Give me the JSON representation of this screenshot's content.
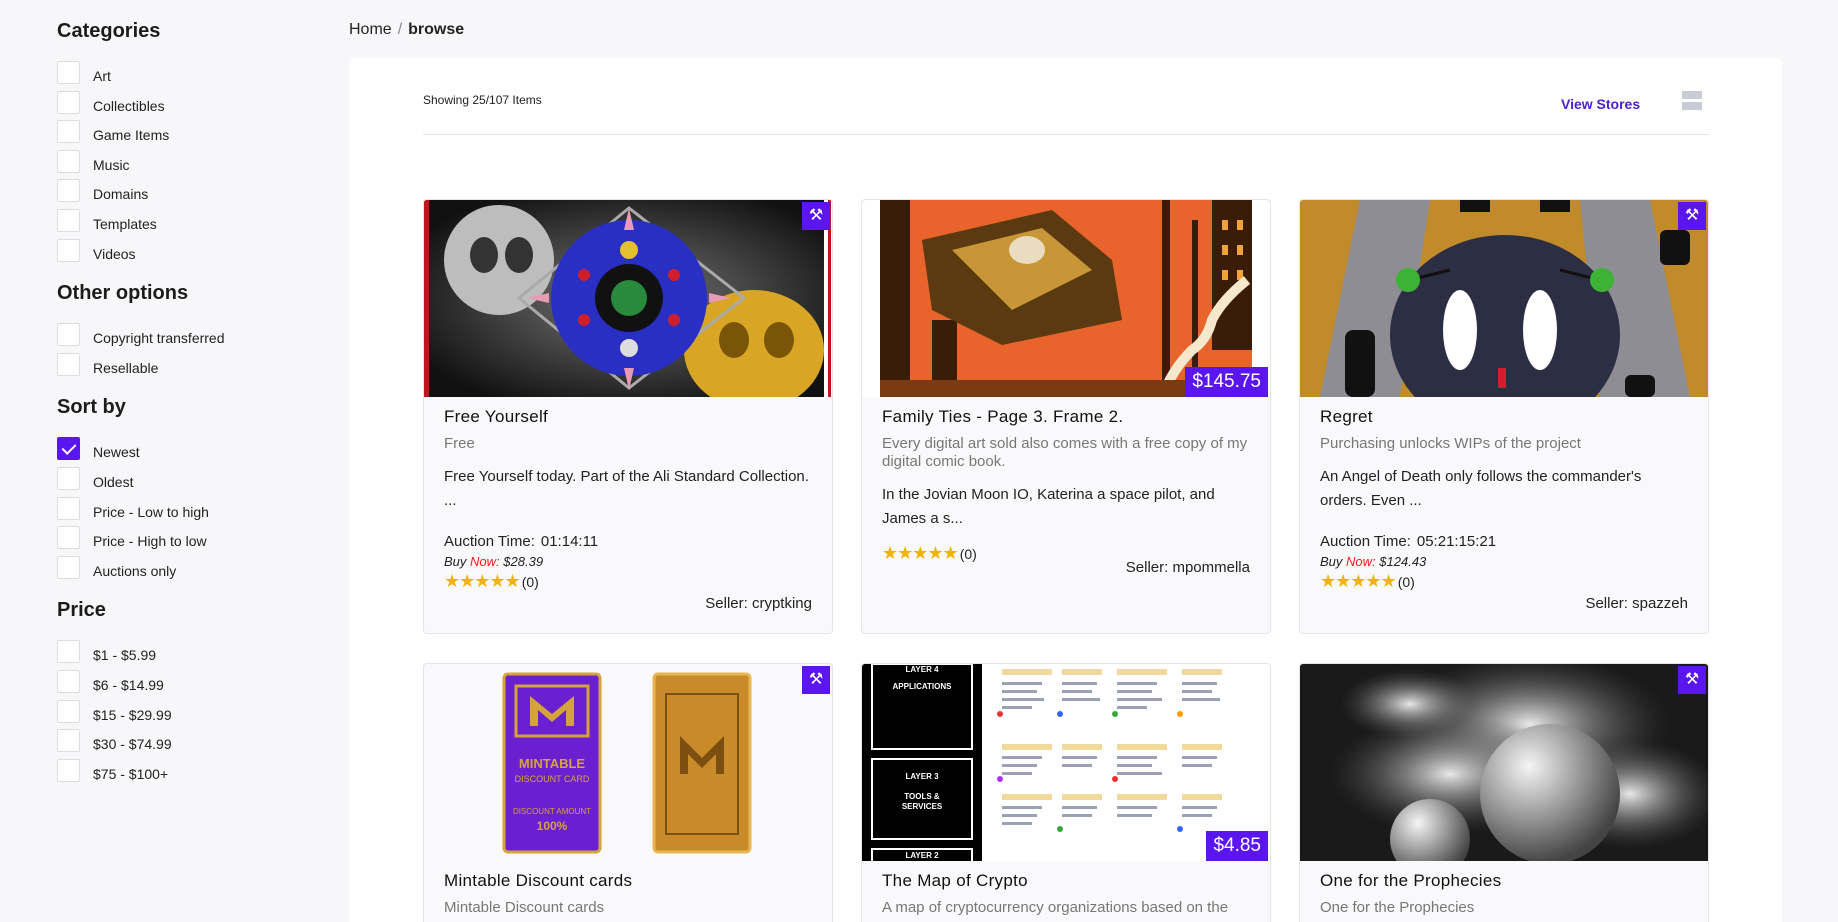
{
  "sidebar": {
    "categories": {
      "heading": "Categories",
      "items": [
        "Art",
        "Collectibles",
        "Game Items",
        "Music",
        "Domains",
        "Templates",
        "Videos"
      ]
    },
    "other": {
      "heading": "Other options",
      "items": [
        "Copyright transferred",
        "Resellable"
      ]
    },
    "sort": {
      "heading": "Sort by",
      "items": [
        "Newest",
        "Oldest",
        "Price - Low to high",
        "Price - High to low",
        "Auctions only"
      ],
      "checked": "Newest"
    },
    "price": {
      "heading": "Price",
      "items": [
        "$1 - $5.99",
        "$6 - $14.99",
        "$15 - $29.99",
        "$30 - $74.99",
        "$75 - $100+"
      ]
    }
  },
  "breadcrumb": {
    "home": "Home",
    "separator": "/",
    "current": "browse"
  },
  "toolbar": {
    "showing": "Showing 25/107 Items",
    "view_stores": "View Stores"
  },
  "icons": {
    "auction": "gavel-icon",
    "star": "star-icon",
    "grid_toggle": "grid-view-icon"
  },
  "colors": {
    "accent": "#5b16f0",
    "link": "#4a1fd3",
    "star": "#f0b400",
    "now": "#ff1a1a"
  },
  "cards": [
    {
      "title": "Free Yourself",
      "subtitle": "Free",
      "description": "Free Yourself today. Part of the Ali Standard Collection. ...",
      "auction_label": "Auction Time:",
      "auction_time": "01:14:11",
      "buy_label": "Buy",
      "now_label": "Now:",
      "buy_price": "$28.39",
      "stars": "★★★★★",
      "rating_count": "(0)",
      "seller": "Seller: cryptking",
      "auction": true
    },
    {
      "title": "Family Ties - Page 3. Frame 2.",
      "subtitle": "Every digital art sold also comes with a free copy of my digital comic book.",
      "description": "In the Jovian Moon IO, Katerina a space pilot, and James a s...",
      "price_tag": "$145.75",
      "stars": "★★★★★",
      "rating_count": "(0)",
      "seller": "Seller: mpommella",
      "auction": false
    },
    {
      "title": "Regret",
      "subtitle": "Purchasing unlocks WIPs of the project",
      "description": "An Angel of Death only follows the commander's orders. Even ...",
      "auction_label": "Auction Time:",
      "auction_time": "05:21:15:21",
      "buy_label": "Buy",
      "now_label": "Now:",
      "buy_price": "$124.43",
      "stars": "★★★★★",
      "rating_count": "(0)",
      "seller": "Seller: spazzeh",
      "auction": true
    },
    {
      "title": "Mintable Discount cards",
      "subtitle": "Mintable Discount cards",
      "auction": true,
      "card_text": [
        "MINTABLE",
        "DISCOUNT CARD",
        "DISCOUNT AMOUNT",
        "100%"
      ]
    },
    {
      "title": "The Map of Crypto",
      "subtitle": "A map of cryptocurrency organizations based on the",
      "price_tag": "$4.85",
      "auction": false,
      "map_labels": [
        "LAYER 4",
        "APPLICATIONS",
        "LAYER 3",
        "TOOLS &",
        "SERVICES",
        "LAYER 2"
      ]
    },
    {
      "title": "One for the Prophecies",
      "subtitle": "One for the Prophecies",
      "auction": true
    }
  ]
}
